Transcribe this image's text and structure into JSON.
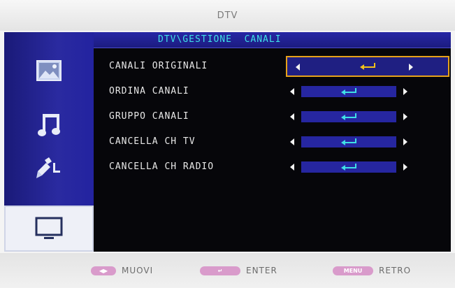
{
  "window": {
    "title": "DTV"
  },
  "header": {
    "breadcrumb": "DTV\\GESTIONE  CANALI"
  },
  "sidebar": {
    "items": [
      {
        "icon": "picture-icon",
        "active": false
      },
      {
        "icon": "music-note-icon",
        "active": false
      },
      {
        "icon": "setup-pen-icon",
        "active": false
      },
      {
        "icon": "tv-icon",
        "active": true
      }
    ]
  },
  "menu": {
    "items": [
      {
        "label": "CANALI ORIGINALI",
        "selected": true
      },
      {
        "label": "ORDINA CANALI",
        "selected": false
      },
      {
        "label": "GRUPPO CANALI",
        "selected": false
      },
      {
        "label": "CANCELLA CH TV",
        "selected": false
      },
      {
        "label": "CANCELLA CH RADIO",
        "selected": false
      }
    ],
    "enter_icon": "enter-arrow-icon"
  },
  "footer": {
    "hints": [
      {
        "key": "◀▶",
        "label": "MUOVI"
      },
      {
        "key": "↵",
        "label": "ENTER"
      },
      {
        "key": "MENU",
        "label": "RETRO"
      }
    ]
  },
  "colors": {
    "sidebar": "#2a2aa0",
    "header_text": "#3fe0e6",
    "selected_border": "#e6a21a",
    "enter_selected": "#f2c21a",
    "enter_normal": "#3fe0e6",
    "hint_pill": "#d99bcb"
  }
}
